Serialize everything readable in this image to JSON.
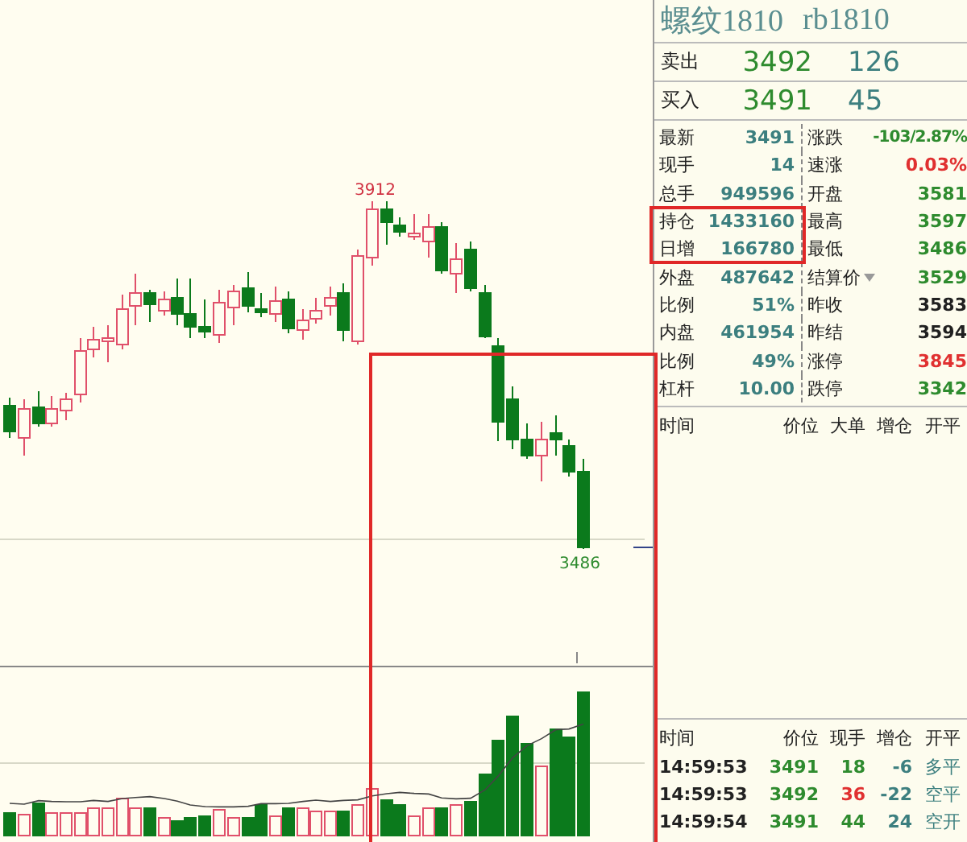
{
  "quote": {
    "name": "螺纹1810",
    "code": "rb1810"
  },
  "order_book": [
    {
      "label": "卖出",
      "price": "3492",
      "volume": "126"
    },
    {
      "label": "买入",
      "price": "3491",
      "volume": "45"
    }
  ],
  "stats": [
    {
      "label": "最新",
      "value": "3491",
      "right_label": "涨跌",
      "right_value": "-103/2.87%",
      "color": "#2e8b2e",
      "has_menu": false
    },
    {
      "label": "现手",
      "value": "14",
      "right_label": "速涨",
      "right_value": "0.03%",
      "color": "#e03030",
      "has_menu": false
    },
    {
      "label": "总手",
      "value": "949596",
      "right_label": "开盘",
      "right_value": "3581",
      "color": "#2e8b2e",
      "has_menu": false
    },
    {
      "label": "持仓",
      "value": "1433160",
      "right_label": "最高",
      "right_value": "3597",
      "color": "#2e8b2e",
      "has_menu": false
    },
    {
      "label": "日增",
      "value": "166780",
      "right_label": "最低",
      "right_value": "3486",
      "color": "#2e8b2e",
      "has_menu": false
    },
    {
      "label": "外盘",
      "value": "487642",
      "right_label": "结算价",
      "right_value": "3529",
      "color": "#2e8b2e",
      "has_menu": true
    },
    {
      "label": "比例",
      "value": "51%",
      "right_label": "昨收",
      "right_value": "3583",
      "color": "#202020",
      "has_menu": false
    },
    {
      "label": "内盘",
      "value": "461954",
      "right_label": "昨结",
      "right_value": "3594",
      "color": "#202020",
      "has_menu": false
    },
    {
      "label": "比例",
      "value": "49%",
      "right_label": "涨停",
      "right_value": "3845",
      "color": "#e03030",
      "has_menu": false
    },
    {
      "label": "杠杆",
      "value": "10.00",
      "right_label": "跌停",
      "right_value": "3342",
      "color": "#2e8b2e",
      "has_menu": false
    }
  ],
  "big_orders": {
    "columns": [
      "时间",
      "价位",
      "大单",
      "增仓",
      "开平"
    ]
  },
  "ticks": {
    "columns": [
      "时间",
      "价位",
      "现手",
      "增仓",
      "开平"
    ],
    "rows": [
      {
        "time": "14:59:53",
        "price": "3491",
        "volume": "18",
        "change": "-6",
        "type": "多平",
        "color": "#2e8b2e"
      },
      {
        "time": "14:59:53",
        "price": "3492",
        "volume": "36",
        "change": "-22",
        "type": "空平",
        "color": "#e03030"
      },
      {
        "time": "14:59:54",
        "price": "3491",
        "volume": "44",
        "change": "24",
        "type": "空开",
        "color": "#2e8b2e"
      }
    ]
  },
  "chart": {
    "high_label": "3912",
    "low_label": "3486"
  }
}
